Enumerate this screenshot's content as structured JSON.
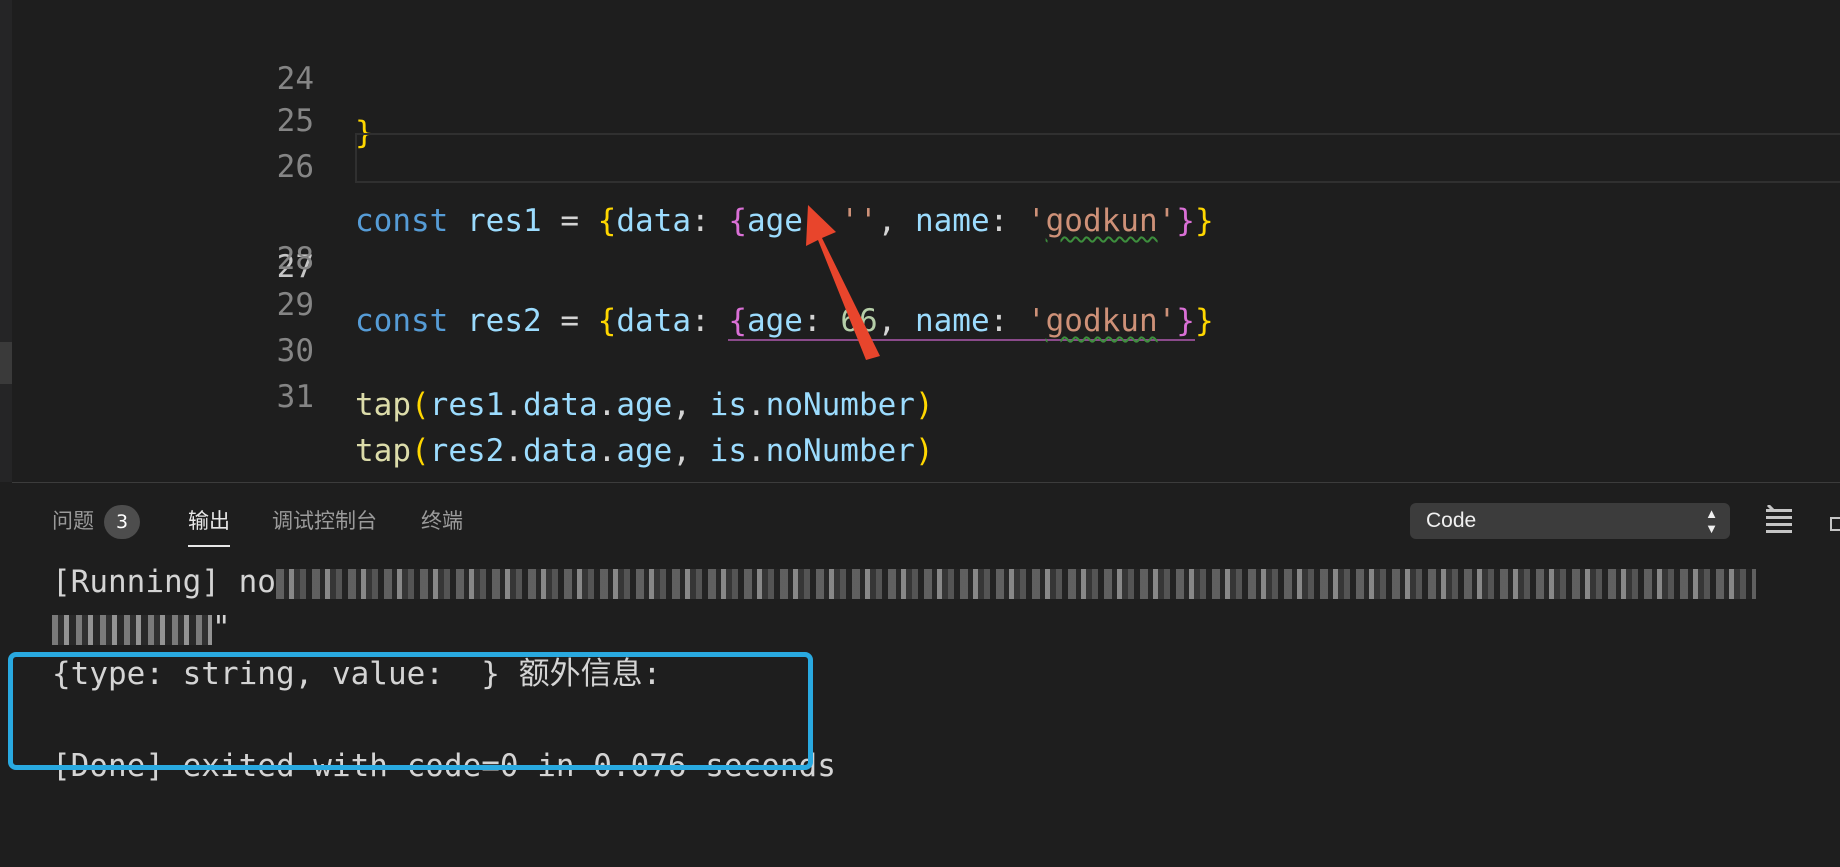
{
  "editor": {
    "lines": [
      {
        "num": "24",
        "code": "}"
      },
      {
        "num": "25",
        "code": ""
      },
      {
        "num": "26",
        "kw": "const",
        "name": "res1",
        "eq": " = ",
        "open1": "{",
        "key": "data",
        "colon": ": ",
        "open2": "{",
        "k1": "age",
        "v1": "''",
        "comma": ", ",
        "k2": "name",
        "v2a": "'",
        "v2b": "godkun",
        "v2c": "'",
        "close2": "}",
        "close1": "}"
      },
      {
        "num": "27",
        "kw": "const",
        "name": "res2",
        "eq": " = ",
        "open1": "{",
        "key": "data",
        "colon": ": ",
        "open2": "{",
        "k1": "age",
        "v1": "66",
        "comma": ", ",
        "k2": "name",
        "v2a": "'",
        "v2b": "godkun",
        "v2c": "'",
        "close2": "}",
        "close1": "}"
      },
      {
        "num": "28",
        "code": ""
      },
      {
        "num": "29",
        "code": ""
      },
      {
        "num": "30",
        "fn": "tap",
        "p1": "(",
        "a": "res1",
        "d1": ".",
        "b": "data",
        "d2": ".",
        "c": "age",
        "comma": ", ",
        "e": "is",
        "d3": ".",
        "f": "noNumber",
        "p2": ")"
      },
      {
        "num": "31",
        "fn": "tap",
        "p1": "(",
        "a": "res2",
        "d1": ".",
        "b": "data",
        "d2": ".",
        "c": "age",
        "comma": ", ",
        "e": "is",
        "d3": ".",
        "f": "noNumber",
        "p2": ")"
      }
    ]
  },
  "panel": {
    "tabs": [
      {
        "label": "问题",
        "badge": "3"
      },
      {
        "label": "输出"
      },
      {
        "label": "调试控制台"
      },
      {
        "label": "终端"
      }
    ],
    "select_value": "Code",
    "output": {
      "running_prefix": "[Running] no",
      "running_tail": "\"",
      "result_line": "{type: string, value:  } 额外信息:",
      "done_line": "[Done] exited with code=0 in 0.076 seconds"
    }
  },
  "colors": {
    "highlight_box": "#29a9e0",
    "annotation_arrow": "#e8452c"
  },
  "icons": [
    "clear-output-icon",
    "maximize-panel-icon",
    "select-arrows-icon",
    "annotation-arrow"
  ]
}
